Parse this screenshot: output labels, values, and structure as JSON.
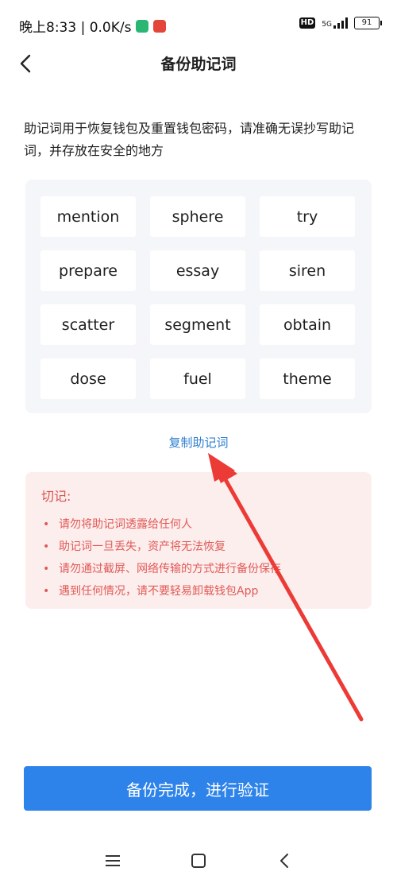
{
  "status_bar": {
    "time_speed": "晚上8:33 | 0.0K/s",
    "hd": "HD",
    "network": "5G",
    "battery": "91"
  },
  "header": {
    "title": "备份助记词",
    "back_icon": "chevron-left-icon"
  },
  "description": "助记词用于恢复钱包及重置钱包密码，请准确无误抄写助记词，并存放在安全的地方",
  "mnemonic_words": [
    "mention",
    "sphere",
    "try",
    "prepare",
    "essay",
    "siren",
    "scatter",
    "segment",
    "obtain",
    "dose",
    "fuel",
    "theme"
  ],
  "copy_link": "复制助记词",
  "warning": {
    "title": "切记:",
    "items": [
      "请勿将助记词透露给任何人",
      "助记词一旦丢失，资产将无法恢复",
      "请勿通过截屏、网络传输的方式进行备份保存",
      "遇到任何情况，请不要轻易卸载钱包App"
    ]
  },
  "primary_button": "备份完成，进行验证",
  "colors": {
    "primary": "#2d83ea",
    "link": "#2f7fd0",
    "warning_text": "#e05a55",
    "warning_bg": "#fdeeee",
    "annotation_arrow": "#ec3b36"
  },
  "system_nav": [
    "menu-icon",
    "home-icon",
    "back-icon"
  ]
}
